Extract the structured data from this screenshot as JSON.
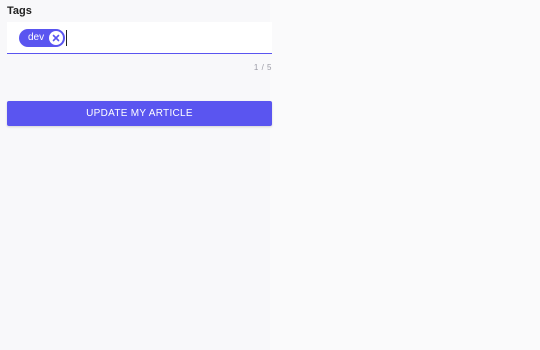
{
  "form": {
    "tags_label": "Tags",
    "tags": [
      {
        "label": "dev",
        "remove_icon": "close-circle-icon"
      }
    ],
    "input_value": "",
    "counter": "1 / 5"
  },
  "actions": {
    "update_label": "UPDATE MY ARTICLE"
  },
  "colors": {
    "accent": "#5a55f0",
    "background": "#f8f8fa",
    "field_background": "#ffffff"
  }
}
